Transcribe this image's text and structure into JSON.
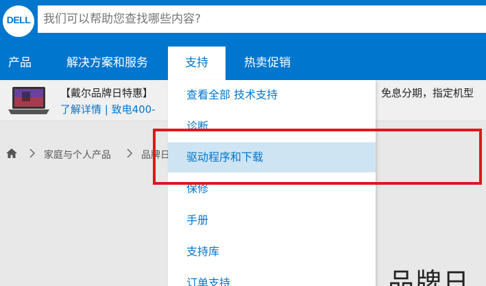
{
  "header": {
    "logo_text": "DELL",
    "search_placeholder": "我们可以帮助您查找哪些内容?"
  },
  "nav": {
    "items": [
      "产品",
      "解决方案和服务",
      "支持",
      "热卖促销"
    ],
    "active": "支持"
  },
  "promo": {
    "title": "【戴尔品牌日特惠】",
    "links": "了解详情 | 致电400-",
    "right_text": "免息分期，指定机型"
  },
  "breadcrumb": {
    "items": [
      "家庭与个人产品",
      "品牌日"
    ]
  },
  "page_title_partial": "品牌日",
  "dropdown": {
    "items": [
      "查看全部 技术支持",
      "诊断",
      "驱动程序和下载",
      "保修",
      "手册",
      "支持库",
      "订单支持"
    ],
    "highlighted": "驱动程序和下载"
  },
  "colors": {
    "brand_blue": "#0076ce",
    "hover_bg": "#cfe4f2",
    "annotation_red": "#e0161b"
  }
}
